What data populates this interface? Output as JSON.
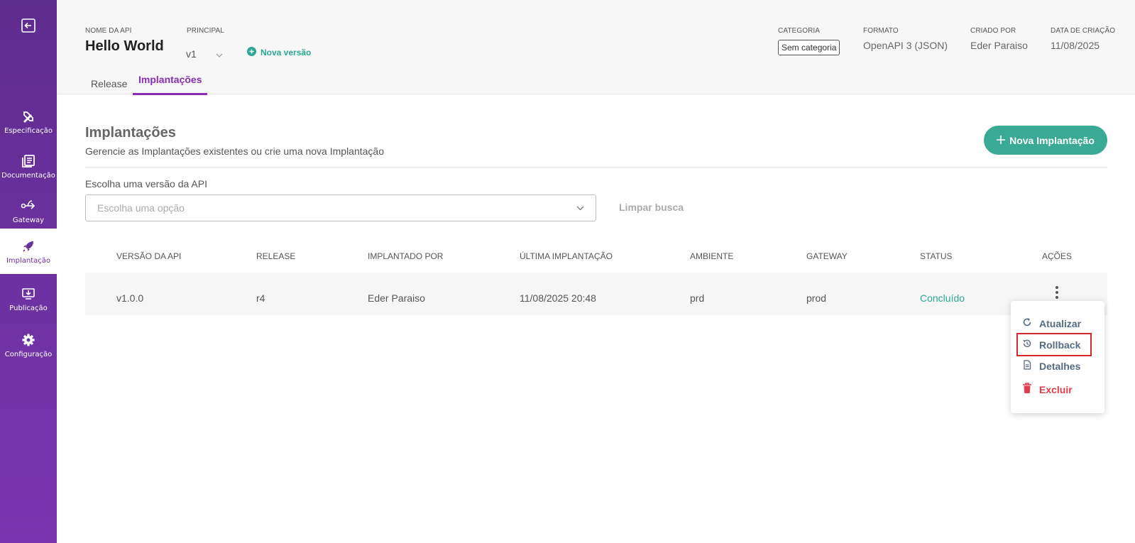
{
  "sidebar": {
    "items": [
      {
        "label": "Especificação",
        "icon": "pencil-ruler-icon"
      },
      {
        "label": "Documentação",
        "icon": "book-icon"
      },
      {
        "label": "Gateway",
        "icon": "gateway-icon"
      },
      {
        "label": "Implantação",
        "icon": "rocket-icon"
      },
      {
        "label": "Publicação",
        "icon": "publish-icon"
      },
      {
        "label": "Configuração",
        "icon": "gear-icon"
      }
    ],
    "active": "Implantação"
  },
  "header": {
    "api_name_label": "NOME DA API",
    "api_name": "Hello World",
    "principal_label": "PRINCIPAL",
    "version": "v1",
    "new_version": "Nova versão",
    "categoria_label": "CATEGORIA",
    "categoria": "Sem categoria",
    "formato_label": "FORMATO",
    "formato": "OpenAPI 3 (JSON)",
    "criado_por_label": "CRIADO POR",
    "criado_por": "Eder Paraiso",
    "data_label": "DATA DE CRIAÇÃO",
    "data": "11/08/2025",
    "tabs": [
      {
        "label": "Release"
      },
      {
        "label": "Implantações"
      }
    ],
    "active_tab": "Implantações"
  },
  "main": {
    "title": "Implantações",
    "subtitle": "Gerencie as Implantações existentes ou crie uma nova Implantação",
    "new_button": "Nova Implantação",
    "filter_label": "Escolha uma versão da API",
    "filter_placeholder": "Escolha uma opção",
    "clear": "Limpar busca",
    "table": {
      "headers": [
        "VERSÃO DA API",
        "RELEASE",
        "IMPLANTADO POR",
        "ÚLTIMA IMPLANTAÇÃO",
        "AMBIENTE",
        "GATEWAY",
        "STATUS",
        "AÇÕES"
      ],
      "rows": [
        {
          "versao": "v1.0.0",
          "release": "r4",
          "implantado_por": "Eder Paraiso",
          "ultima": "11/08/2025 20:48",
          "ambiente": "prd",
          "gateway": "prod",
          "status": "Concluído"
        }
      ]
    },
    "actions_menu": [
      {
        "label": "Atualizar",
        "icon": "refresh-icon"
      },
      {
        "label": "Rollback",
        "icon": "history-icon"
      },
      {
        "label": "Detalhes",
        "icon": "document-icon"
      },
      {
        "label": "Excluir",
        "icon": "trash-icon"
      }
    ]
  },
  "colors": {
    "sidebar": "#6a2fa0",
    "accent": "#8a2db5",
    "teal": "#3aaa94",
    "danger": "#e03c4c",
    "highlight": "#d8262b"
  }
}
